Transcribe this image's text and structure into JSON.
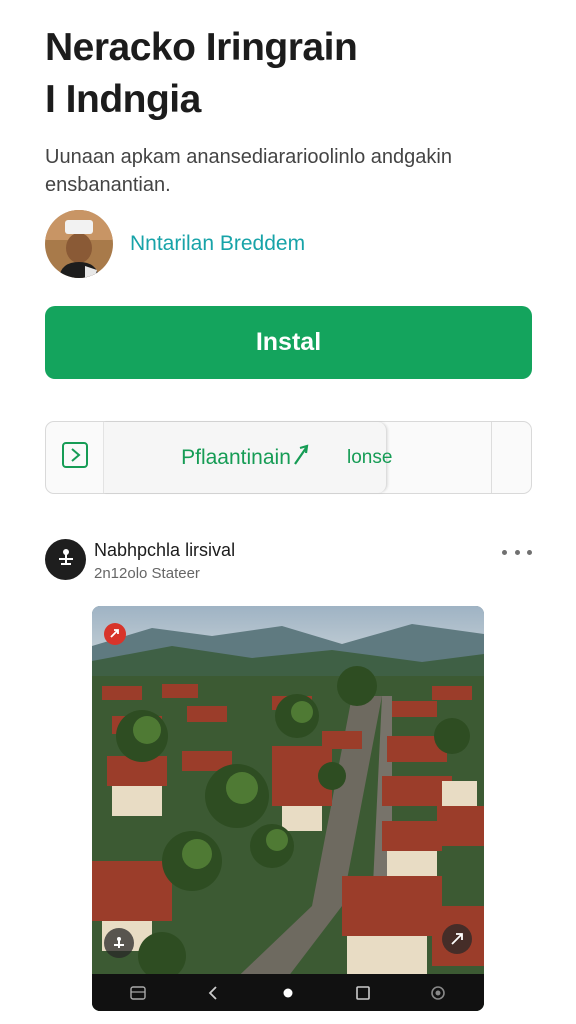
{
  "app": {
    "title_line1": "Neracko Iringrain",
    "title_line2": "I Indngia",
    "description_line1": "Uunaan apkam anansediararioolinlo andgakin",
    "description_line2": "ensbanantian.",
    "developer": "Nntarilan Breddem"
  },
  "buttons": {
    "install": "Instal",
    "primary_action": "Pflaantinain",
    "secondary_action": "lonse"
  },
  "post": {
    "author": "Nabhpchla lirsival",
    "time": "2n12olo Stateer"
  },
  "colors": {
    "install_bg": "#14a45d",
    "accent_green": "#169c55",
    "developer_link": "#17a3a8"
  },
  "icons": {
    "action_icon": "play-box-icon",
    "post_avatar": "tool-icon",
    "more": "more-horizontal-icon",
    "photo_badge": "record-icon",
    "nav": [
      "menu-icon",
      "back-icon",
      "home-icon",
      "recents-icon",
      "assistant-icon"
    ]
  }
}
